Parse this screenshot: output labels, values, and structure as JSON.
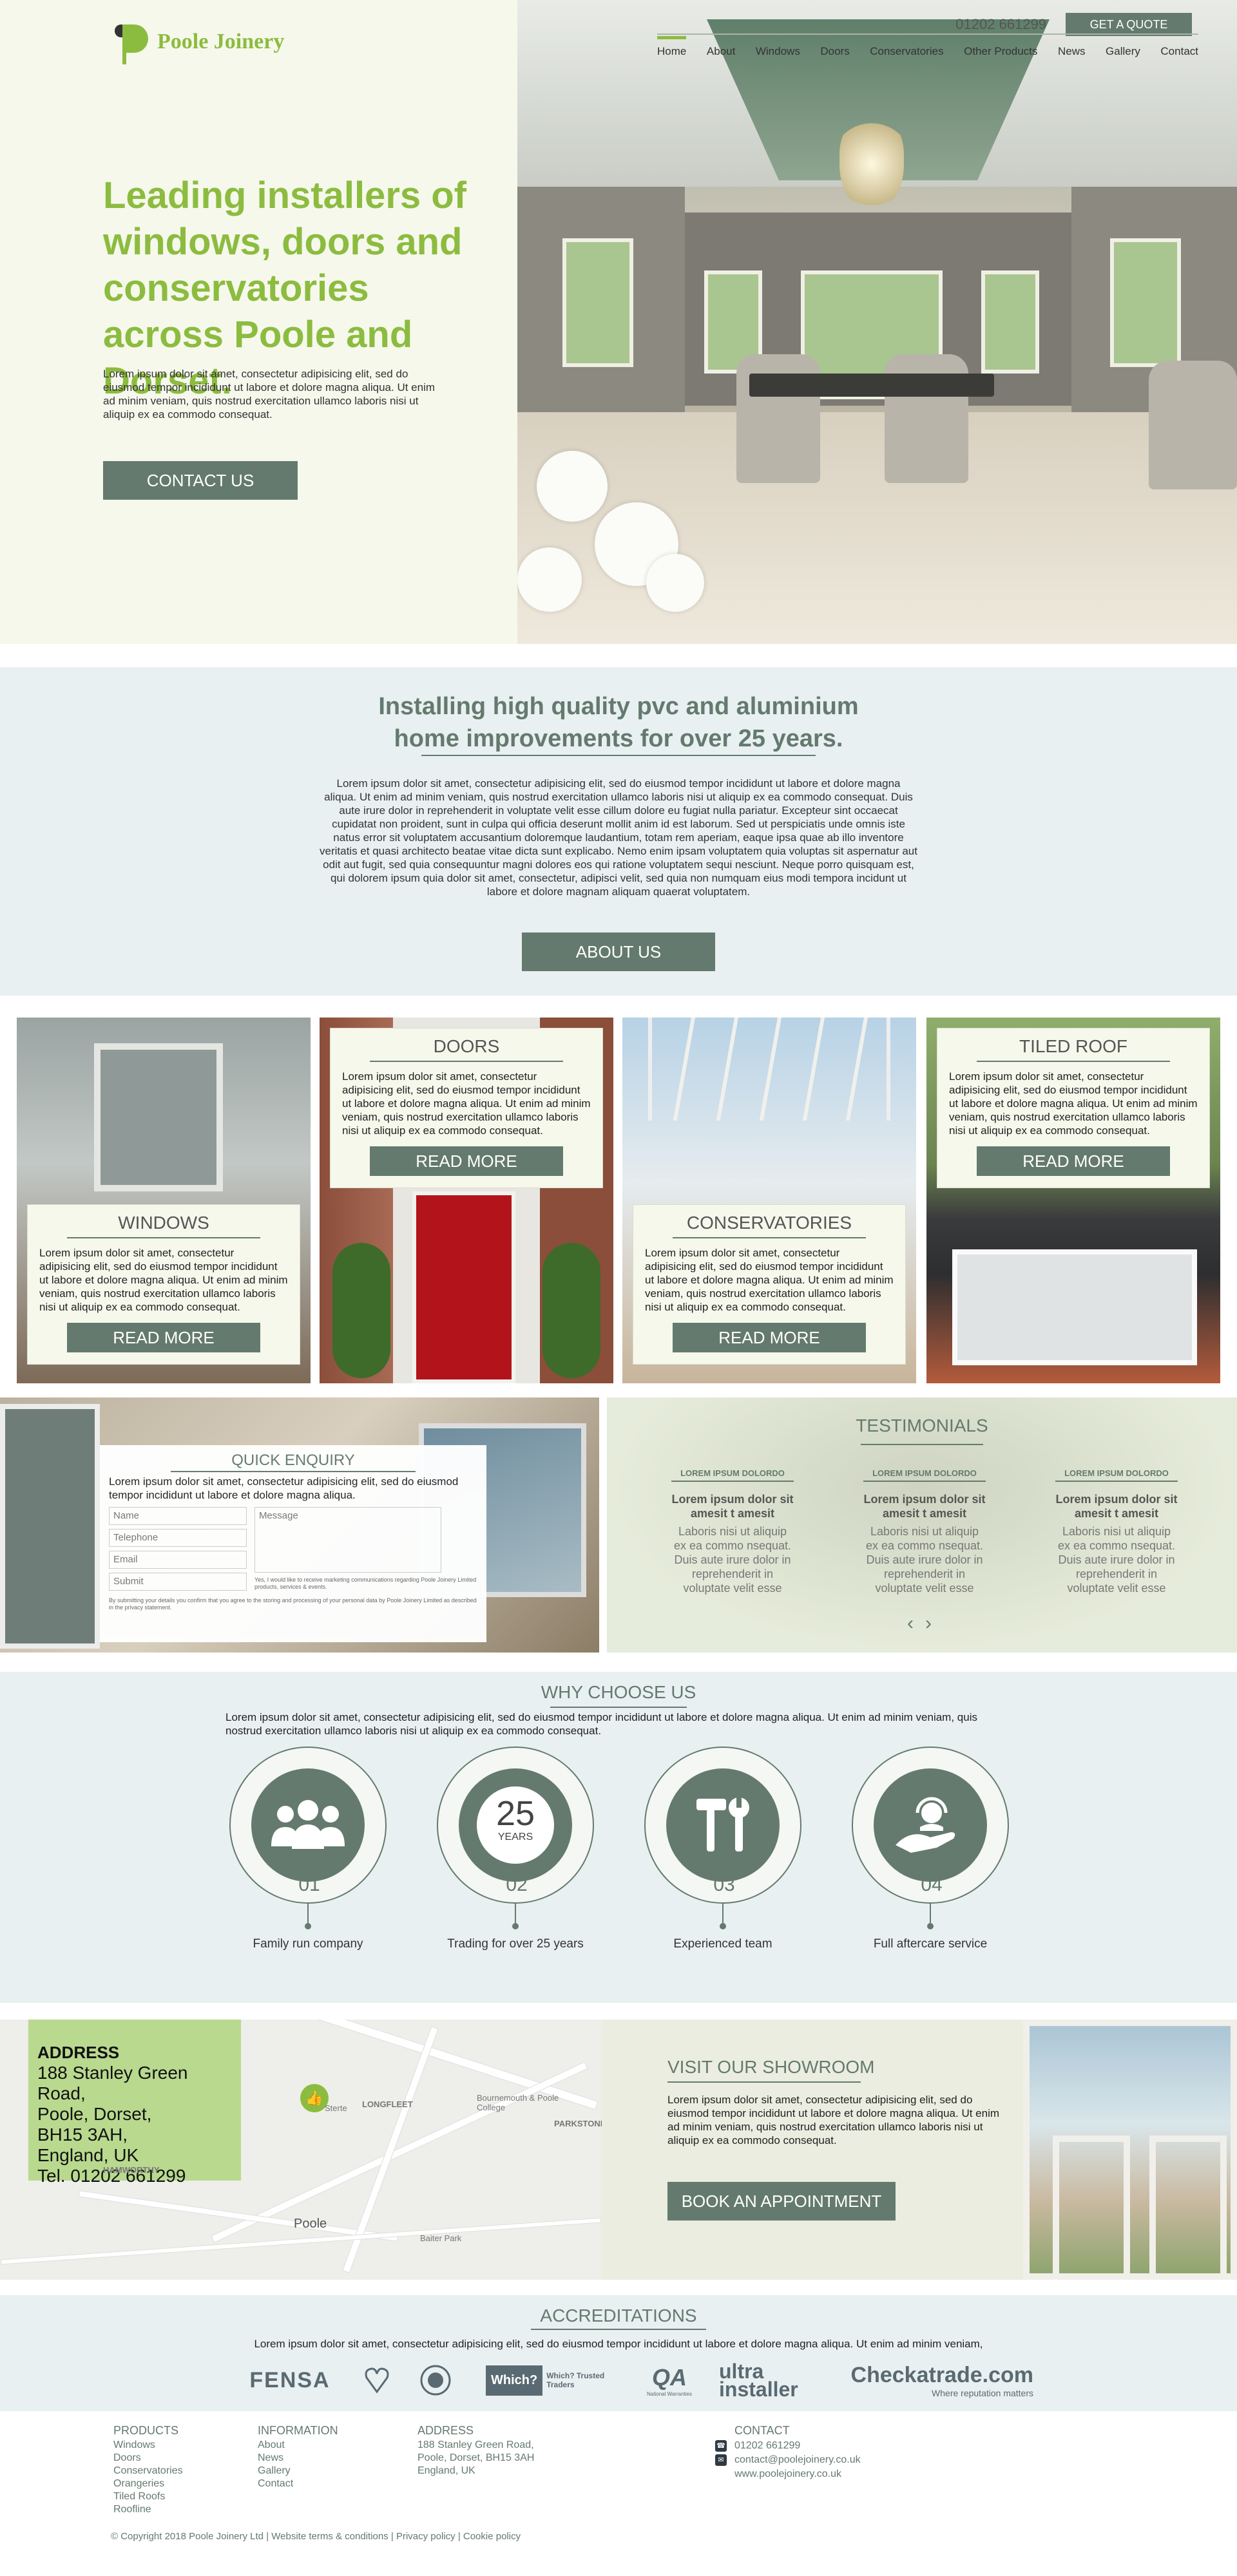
{
  "brand": {
    "name": "Poole Joinery",
    "accent": "#8cbc3f",
    "primary": "#647a6e"
  },
  "header": {
    "phone": "01202 661299",
    "quote_label": "GET A QUOTE",
    "nav": [
      {
        "label": "Home",
        "active": true
      },
      {
        "label": "About"
      },
      {
        "label": "Windows"
      },
      {
        "label": "Doors"
      },
      {
        "label": "Conservatories"
      },
      {
        "label": "Other Products"
      },
      {
        "label": "News"
      },
      {
        "label": "Gallery"
      },
      {
        "label": "Contact"
      }
    ]
  },
  "hero": {
    "title": "Leading installers of windows, doors and conservatories across Poole and Dorset.",
    "text": "Lorem ipsum dolor sit amet, consectetur adipisicing elit, sed do eiusmod tempor incididunt ut labore et dolore magna aliqua. Ut enim ad minim veniam, quis nostrud exercitation ullamco laboris nisi ut aliquip ex ea commodo consequat.",
    "button": "CONTACT US"
  },
  "installing": {
    "title": "Installing high quality pvc and aluminium home improvements for over 25 years.",
    "text": "Lorem ipsum dolor sit amet, consectetur adipisicing elit, sed do eiusmod tempor incididunt ut labore et dolore magna aliqua. Ut enim ad minim veniam, quis nostrud exercitation ullamco laboris nisi ut aliquip ex ea commodo consequat. Duis aute irure dolor in reprehenderit in voluptate velit esse cillum dolore eu fugiat nulla pariatur. Excepteur sint occaecat cupidatat non proident, sunt in culpa qui officia deserunt mollit anim id est laborum. Sed ut perspiciatis unde omnis iste natus error sit voluptatem accusantium doloremque laudantium, totam rem aperiam, eaque ipsa quae ab illo inventore veritatis et quasi architecto beatae vitae dicta sunt explicabo. Nemo enim ipsam voluptatem quia voluptas sit aspernatur aut odit aut fugit, sed quia consequuntur magni dolores eos qui ratione voluptatem sequi nesciunt. Neque porro quisquam est, qui dolorem ipsum quia dolor sit amet, consectetur, adipisci velit, sed quia non numquam eius modi tempora incidunt ut labore et dolore magnam aliquam quaerat voluptatem.",
    "button": "ABOUT US"
  },
  "products": [
    {
      "title": "WINDOWS",
      "text": "Lorem ipsum dolor sit amet, consectetur adipisicing elit, sed do eiusmod tempor incididunt ut labore et dolore magna aliqua. Ut enim ad minim veniam, quis nostrud exercitation ullamco laboris nisi ut aliquip ex ea commodo consequat.",
      "button": "READ MORE"
    },
    {
      "title": "DOORS",
      "text": "Lorem ipsum dolor sit amet, consectetur adipisicing elit, sed do eiusmod tempor incididunt ut labore et dolore magna aliqua. Ut enim ad minim veniam, quis nostrud exercitation ullamco laboris nisi ut aliquip ex ea commodo consequat.",
      "button": "READ MORE"
    },
    {
      "title": "CONSERVATORIES",
      "text": "Lorem ipsum dolor sit amet, consectetur adipisicing elit, sed do eiusmod tempor incididunt ut labore et dolore magna aliqua. Ut enim ad minim veniam, quis nostrud exercitation ullamco laboris nisi ut aliquip ex ea commodo consequat.",
      "button": "READ MORE"
    },
    {
      "title": "TILED ROOF",
      "text": "Lorem ipsum dolor sit amet, consectetur adipisicing elit, sed do eiusmod tempor incididunt ut labore et dolore magna aliqua. Ut enim ad minim veniam, quis nostrud exercitation ullamco laboris nisi ut aliquip ex ea commodo consequat.",
      "button": "READ MORE"
    }
  ],
  "enquiry": {
    "title": "QUICK ENQUIRY",
    "intro": "Lorem ipsum dolor sit amet, consectetur adipisicing elit, sed do eiusmod tempor incididunt ut labore et dolore magna aliqua.",
    "name_placeholder": "Name",
    "telephone_placeholder": "Telephone",
    "email_placeholder": "Email",
    "message_placeholder": "Message",
    "submit": "Submit",
    "consent": "Yes, I would like to receive marketing communications regarding Poole Joinery Limited products, services & events.",
    "privacy": "By submitting your details you confirm that you agree to the storing and processing of your personal data by Poole Joinery Limited as described in the privacy statement."
  },
  "testimonials": {
    "title": "TESTIMONIALS",
    "items": [
      {
        "heading": "LOREM IPSUM DOLORDO",
        "bold": "Lorem ipsum dolor sit amesit  t amesit",
        "text": "Laboris nisi ut aliquip ex ea commo nsequat. Duis aute irure dolor in reprehenderit in voluptate velit esse"
      },
      {
        "heading": "LOREM IPSUM DOLORDO",
        "bold": "Lorem ipsum dolor sit amesit  t amesit",
        "text": "Laboris nisi ut aliquip ex ea commo nsequat. Duis aute irure dolor in reprehenderit in voluptate velit esse"
      },
      {
        "heading": "LOREM IPSUM DOLORDO",
        "bold": "Lorem ipsum dolor sit amesit  t amesit",
        "text": "Laboris nisi ut aliquip ex ea commo nsequat. Duis aute irure dolor in reprehenderit in voluptate velit esse"
      }
    ],
    "prev": "‹",
    "next": "›"
  },
  "why": {
    "title": "WHY CHOOSE US",
    "text": "Lorem ipsum dolor sit amet, consectetur adipisicing elit, sed do eiusmod tempor incididunt ut labore et dolore magna aliqua. Ut enim ad minim veniam, quis nostrud exercitation ullamco laboris nisi ut aliquip ex ea commodo consequat.",
    "items": [
      {
        "num": "01",
        "label": "Family run company",
        "icon": "family-icon"
      },
      {
        "num": "02",
        "label": "Trading for over 25 years",
        "icon": "25-years-badge-icon",
        "badge_num": "25",
        "badge_text": "YEARS"
      },
      {
        "num": "03",
        "label": "Experienced team",
        "icon": "tools-icon"
      },
      {
        "num": "04",
        "label": "Full aftercare service",
        "icon": "support-hand-icon"
      }
    ]
  },
  "address": {
    "heading": "ADDRESS",
    "lines": [
      "188 Stanley Green Road,",
      "Poole, Dorset,",
      "BH15 3AH,",
      "England, UK",
      "Tel. 01202 661299"
    ]
  },
  "map_labels": [
    "LONGFLEET",
    "Bournemouth & Poole College",
    "PARKSTONE",
    "HAMWORTHY",
    "Poole",
    "Baiter Park",
    "Sterte"
  ],
  "showroom": {
    "title": "VISIT OUR SHOWROOM",
    "text": "Lorem ipsum dolor sit amet, consectetur adipisicing elit, sed do eiusmod tempor incididunt ut labore et dolore magna aliqua. Ut enim ad minim veniam, quis nostrud exercitation ullamco laboris nisi ut aliquip ex ea commodo consequat.",
    "button": "BOOK AN APPOINTMENT"
  },
  "accreditations": {
    "title": "ACCREDITATIONS",
    "text": "Lorem ipsum dolor sit amet, consectetur adipisicing elit, sed do eiusmod tempor incididunt ut labore et dolore magna aliqua. Ut enim ad minim veniam,",
    "logos": [
      "FENSA",
      "Which? Trusted Traders",
      "ultra installer",
      "Checkatrade.com",
      "Where reputation matters",
      "QA",
      "National Warranties"
    ]
  },
  "footer": {
    "products": {
      "heading": "PRODUCTS",
      "items": [
        "Windows",
        "Doors",
        "Conservatories",
        "Orangeries",
        "Tiled Roofs",
        "Roofline"
      ]
    },
    "information": {
      "heading": "INFORMATION",
      "items": [
        "About",
        "News",
        "Gallery",
        "Contact"
      ]
    },
    "address": {
      "heading": "ADDRESS",
      "items": [
        "188 Stanley Green Road,",
        "Poole, Dorset, BH15 3AH",
        "England, UK"
      ]
    },
    "contact": {
      "heading": "CONTACT",
      "phone": "01202 661299",
      "email": "contact@poolejoinery.co.uk",
      "web": "www.poolejoinery.co.uk"
    },
    "copyright": "© Copyright 2018 Poole Joinery Ltd | Website terms & conditions | Privacy policy | Cookie policy"
  }
}
